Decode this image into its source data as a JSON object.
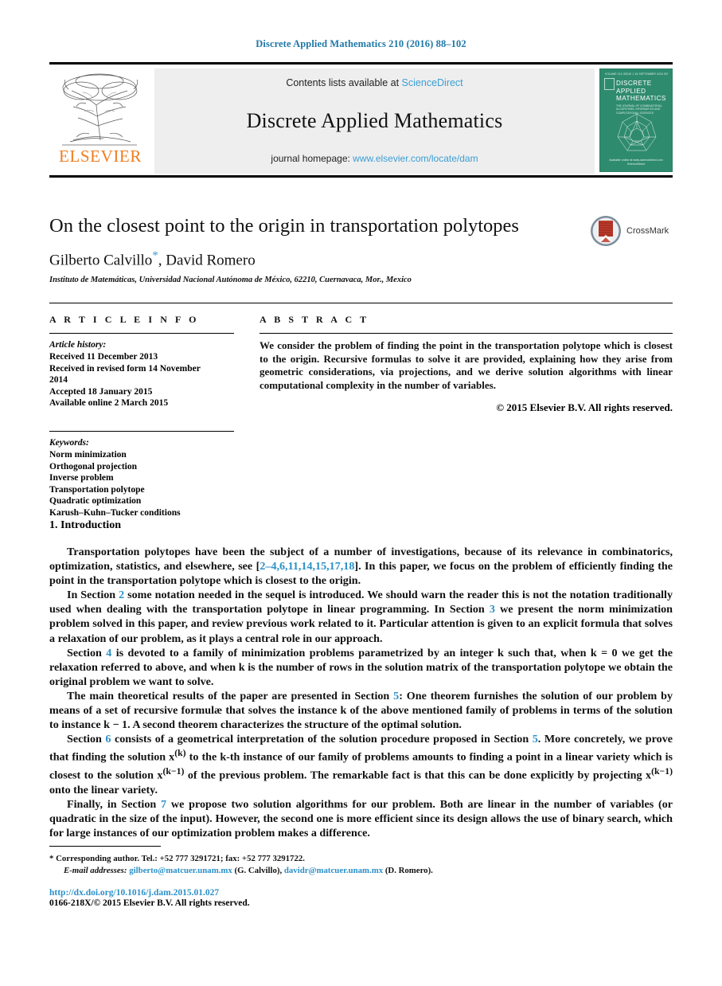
{
  "running_head": "Discrete Applied Mathematics 210 (2016) 88–102",
  "masthead": {
    "contents_prefix": "Contents lists available at",
    "sciencedirect": "ScienceDirect",
    "journal_title": "Discrete Applied Mathematics",
    "homepage_prefix": "journal homepage:",
    "homepage_url": "www.elsevier.com/locate/dam",
    "publisher": "ELSEVIER",
    "cover": {
      "top_strip": "VOLUME 210   ISSUE 1   15 SEPTEMBER 2016   ISSN 0166-218X",
      "title_line1": "DISCRETE",
      "title_line2": "APPLIED",
      "title_line3": "MATHEMATICS",
      "subtitle": "THE JOURNAL OF COMBINATORIAL ALGORITHMS, INFORMATICS AND COMPUTATIONAL SCIENCES",
      "foot_line1": "Available online at www.sciencedirect.com",
      "foot_line2": "ScienceDirect"
    }
  },
  "article": {
    "title": "On the closest point to the origin in transportation polytopes",
    "authors": "Gilberto Calvillo",
    "author_marker": "*",
    "authors_rest": ", David Romero",
    "affiliation": "Instituto de Matemáticas, Universidad Nacional Autónoma de México, 62210, Cuernavaca, Mor., Mexico",
    "crossmark_label": "CrossMark"
  },
  "article_info": {
    "heading": "A R T I C L E   I N F O",
    "history_label": "Article history:",
    "history": [
      "Received 11 December 2013",
      "Received in revised form 14 November",
      "2014",
      "Accepted 18 January 2015",
      "Available online 2 March 2015"
    ],
    "keywords_label": "Keywords:",
    "keywords": [
      "Norm minimization",
      "Orthogonal projection",
      "Inverse problem",
      "Transportation polytope",
      "Quadratic optimization",
      "Karush–Kuhn–Tucker conditions"
    ]
  },
  "abstract": {
    "heading": "A B S T R A C T",
    "text": "We consider the problem of finding the point in the transportation polytope which is closest to the origin. Recursive formulas to solve it are provided, explaining how they arise from geometric considerations, via projections, and we derive solution algorithms with linear computational complexity in the number of variables.",
    "copyright": "© 2015 Elsevier B.V. All rights reserved."
  },
  "body": {
    "section_number": "1.",
    "section_title": "Introduction",
    "paragraphs": {
      "p1_a": "Transportation polytopes have been the subject of a number of investigations, because of its relevance in combinatorics, optimization, statistics, and elsewhere, see [",
      "p1_cites": "2–4,6,11,14,15,17,18",
      "p1_b": "]. In this paper, we focus on the problem of efficiently finding the point in the transportation polytope which is closest to the origin.",
      "p2_a": "In Section ",
      "p2_ref1": "2",
      "p2_b": " some notation needed in the sequel is introduced. We should warn the reader this is not the notation traditionally used when dealing with the transportation polytope in linear programming. In Section ",
      "p2_ref2": "3",
      "p2_c": " we present the norm minimization problem solved in this paper, and review previous work related to it. Particular attention is given to an explicit formula that solves a relaxation of our problem, as it plays a central role in our approach.",
      "p3_a": "Section ",
      "p3_ref": "4",
      "p3_b": " is devoted to a family of minimization problems parametrized by an integer k such that, when k = 0 we get the relaxation referred to above, and when k is the number of rows in the solution matrix of the transportation polytope we obtain the original problem we want to solve.",
      "p4_a": "The main theoretical results of the paper are presented in Section ",
      "p4_ref": "5",
      "p4_b": ": One theorem furnishes the solution of our problem by means of a set of recursive formulæ that solves the instance k of the above mentioned family of problems in terms of the solution to instance k − 1. A second theorem characterizes the structure of the optimal solution.",
      "p5_a": "Section ",
      "p5_ref1": "6",
      "p5_b": " consists of a geometrical interpretation of the solution procedure proposed in Section ",
      "p5_ref2": "5",
      "p5_c": ". More concretely, we prove that finding the solution x",
      "p5_sup1": "(k)",
      "p5_d": " to the k-th instance of our family of problems amounts to finding a point in a linear variety which is closest to the solution x",
      "p5_sup2": "(k−1)",
      "p5_e": " of the previous problem. The remarkable fact is that this can be done explicitly by projecting x",
      "p5_sup3": "(k−1)",
      "p5_f": " onto the linear variety.",
      "p6_a": "Finally, in Section ",
      "p6_ref": "7",
      "p6_b": " we propose two solution algorithms for our problem. Both are linear in the number of variables (or quadratic in the size of the input). However, the second one is more efficient since its design allows the use of binary search, which for large instances of our optimization problem makes a difference."
    }
  },
  "footnotes": {
    "corresponding": "Corresponding author. Tel.: +52 777 3291721; fax: +52 777 3291722.",
    "email_label": "E-mail addresses:",
    "email1": "gilberto@matcuer.unam.mx",
    "email1_name": "(G. Calvillo),",
    "email2": "davidr@matcuer.unam.mx",
    "email2_name": "(D. Romero).",
    "doi": "http://dx.doi.org/10.1016/j.dam.2015.01.027",
    "issn": "0166-218X/© 2015 Elsevier B.V. All rights reserved."
  },
  "colors": {
    "link_blue": "#2b90c8",
    "sciencedirect_blue": "#3a9ed4",
    "elsevier_orange": "#f07c1e",
    "cover_green": "#2f8b6e",
    "crossmark_red": "#c0392b"
  }
}
